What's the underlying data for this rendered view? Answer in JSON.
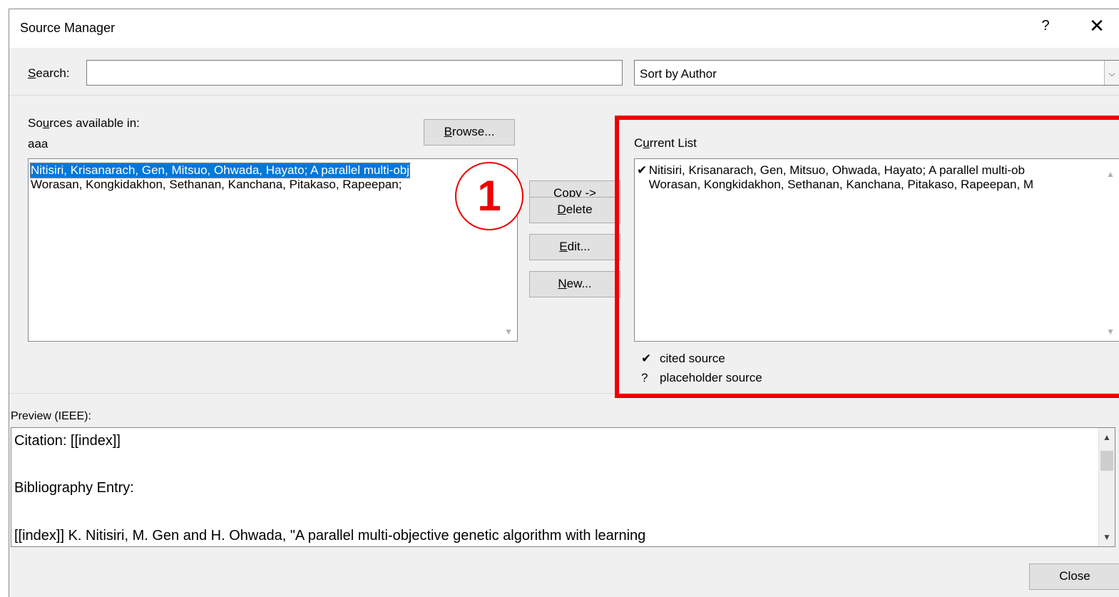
{
  "window": {
    "title": "Source Manager",
    "help": "?",
    "close_symbol": "✕"
  },
  "search": {
    "label_prefix": "S",
    "label_rest": "earch:",
    "value": "",
    "placeholder": ""
  },
  "sort": {
    "selected": "Sort by Author",
    "arrow": "⌵"
  },
  "sources": {
    "label_prefix": "So",
    "label_u": "u",
    "label_rest": "rces available in:",
    "location": "aaa",
    "browse_u": "B",
    "browse_rest": "rowse...",
    "items": [
      "Nitisiri, Krisanarach, Gen, Mitsuo, Ohwada, Hayato; A parallel multi-obj",
      "Worasan, Kongkidakhon, Sethanan, Kanchana, Pitakaso, Rapeepan; "
    ]
  },
  "actions": {
    "copy_u": "C",
    "copy_rest": "opy ->",
    "delete_u": "D",
    "delete_rest": "elete",
    "edit_u": "E",
    "edit_rest": "dit...",
    "new_u": "N",
    "new_rest": "ew..."
  },
  "current": {
    "label_prefix": "C",
    "label_u": "u",
    "label_rest": "rrent List",
    "items": [
      {
        "mark": "✔",
        "text": "Nitisiri, Krisanarach, Gen, Mitsuo, Ohwada, Hayato; A parallel multi-ob"
      },
      {
        "mark": "",
        "text": "Worasan, Kongkidakhon, Sethanan, Kanchana, Pitakaso, Rapeepan, M"
      }
    ],
    "legend": [
      {
        "mark": "✔",
        "text": "cited source"
      },
      {
        "mark": "?",
        "text": "placeholder source"
      }
    ]
  },
  "annotation": {
    "number": "1",
    "accent": "#ee0000"
  },
  "preview": {
    "label": "Preview (IEEE):",
    "citation": "Citation:  [[index]]",
    "bib_label": "Bibliography Entry:",
    "bib_entry": "[[index]] K. Nitisiri, M. Gen and H. Ohwada, \"A parallel multi-objective genetic algorithm with learning"
  },
  "footer": {
    "close_label": "Close"
  },
  "colors": {
    "selection": "#0078d7",
    "highlight_border": "#ee0000"
  }
}
